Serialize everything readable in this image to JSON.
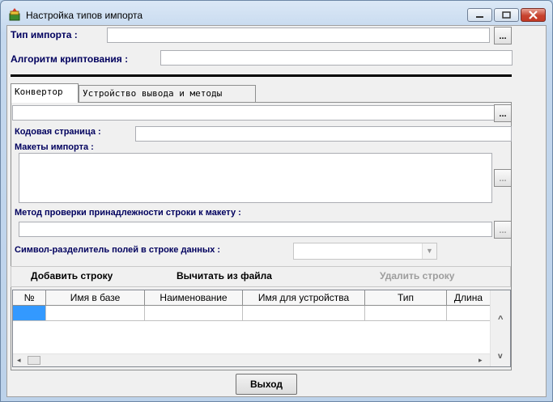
{
  "window": {
    "title": "Настройка типов импорта"
  },
  "form": {
    "import_type_label": "Тип импорта :",
    "import_type_value": "",
    "browse_label": "...",
    "crypto_label": "Алгоритм криптования :",
    "crypto_value": ""
  },
  "tabs": [
    {
      "label": "Конвертор",
      "active": true
    },
    {
      "label": "Устройство вывода и методы",
      "active": false
    }
  ],
  "converter": {
    "path_value": "",
    "codepage_label": "Кодовая страница :",
    "codepage_value": "",
    "layouts_label": "Макеты импорта :",
    "method_label": "Метод проверки принадлежности строки к макету :",
    "method_value": "",
    "separator_label": "Символ-разделитель полей в строке данных :",
    "separator_value": ""
  },
  "toolbar": {
    "add_row": "Добавить строку",
    "read_file": "Вычитать из файла",
    "delete_row": "Удалить строку"
  },
  "grid": {
    "columns": [
      "№",
      "Имя в базе",
      "Наименование",
      "Имя для устройства",
      "Тип",
      "Длина"
    ],
    "rows": [
      [
        "",
        "",
        "",
        "",
        "",
        ""
      ]
    ]
  },
  "footer": {
    "exit_label": "Выход"
  },
  "scroll": {
    "up": "^",
    "down": "v",
    "left": "◂",
    "right": "▸"
  }
}
